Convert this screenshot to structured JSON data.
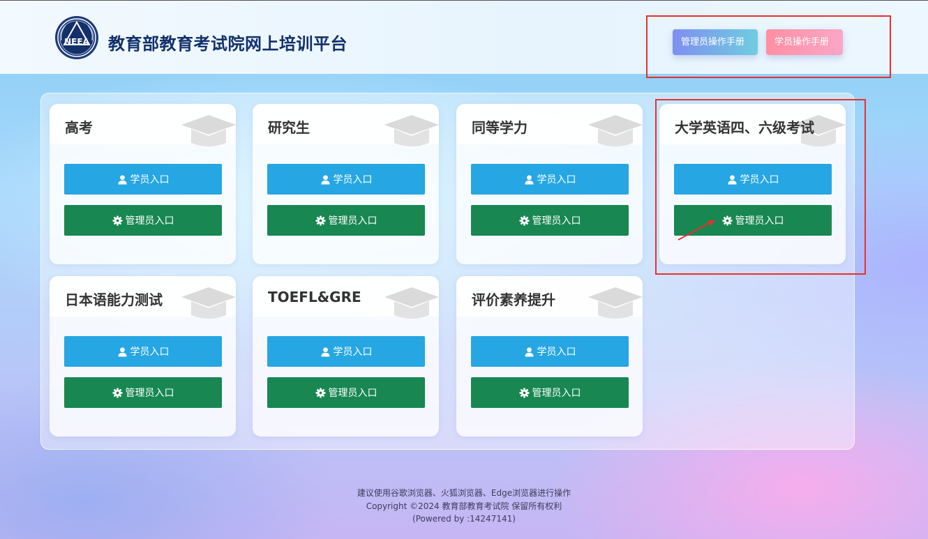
{
  "header": {
    "site_title": "教育部教育考试院网上培训平台",
    "logo_text": "NEEA",
    "admin_manual_label": "管理员操作手册",
    "student_manual_label": "学员操作手册"
  },
  "cards": [
    {
      "title": "高考",
      "student_label": "学员入口",
      "admin_label": "管理员入口"
    },
    {
      "title": "研究生",
      "student_label": "学员入口",
      "admin_label": "管理员入口"
    },
    {
      "title": "同等学力",
      "student_label": "学员入口",
      "admin_label": "管理员入口"
    },
    {
      "title": "大学英语四、六级考试",
      "student_label": "学员入口",
      "admin_label": "管理员入口"
    },
    {
      "title": "日本语能力测试",
      "student_label": "学员入口",
      "admin_label": "管理员入口"
    },
    {
      "title": "TOEFL&GRE",
      "student_label": "学员入口",
      "admin_label": "管理员入口"
    },
    {
      "title": "评价素养提升",
      "student_label": "学员入口",
      "admin_label": "管理员入口"
    }
  ],
  "footer": {
    "line1": "建议使用谷歌浏览器、火狐浏览器、Edge浏览器进行操作",
    "line2": "Copyright ©2024 教育部教育考试院 保留所有权利",
    "line3": "(Powered by :14247141)"
  },
  "colors": {
    "student_button": "#26a6e3",
    "admin_button": "#188752",
    "title": "#12306b",
    "highlight_box": "#e83030"
  },
  "icons": {
    "student_button": "user-icon",
    "admin_button": "gear-icon",
    "card_decoration": "graduation-cap-icon"
  }
}
